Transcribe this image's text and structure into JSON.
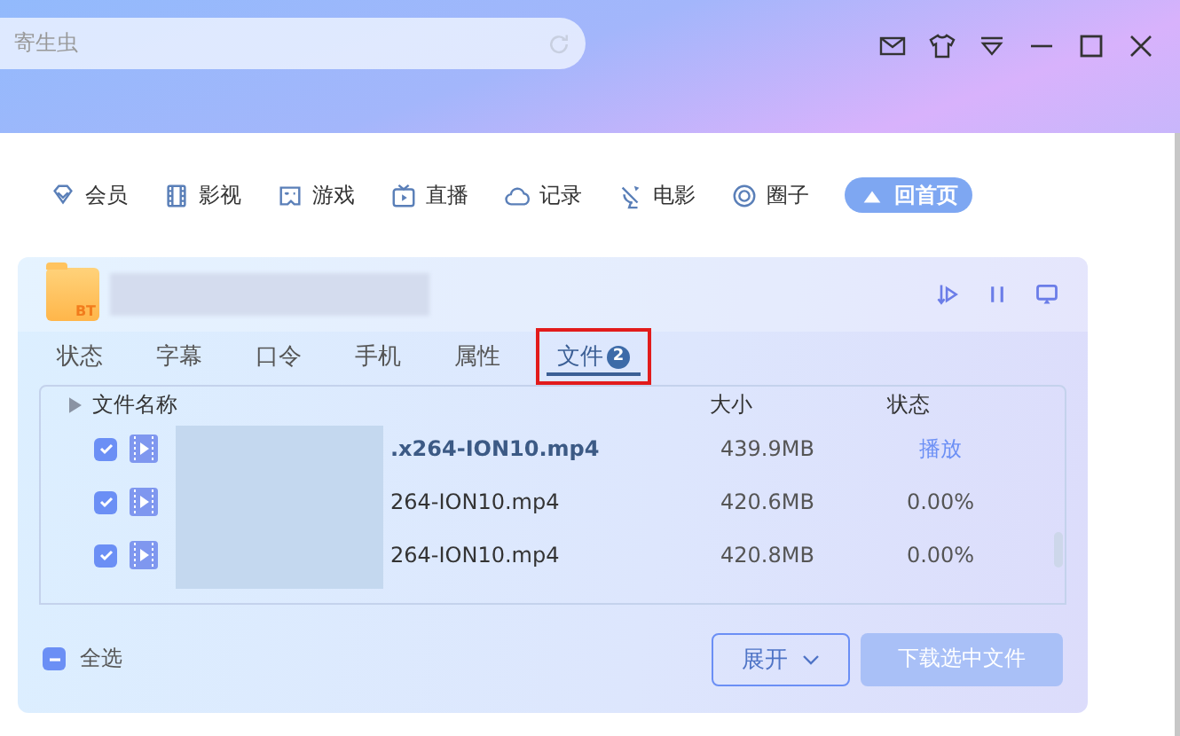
{
  "search": {
    "value": "寄生虫"
  },
  "nav": [
    {
      "label": "会员",
      "kind": "diamond",
      "selected": false
    },
    {
      "label": "影视",
      "kind": "film",
      "selected": false
    },
    {
      "label": "游戏",
      "kind": "game",
      "selected": false
    },
    {
      "label": "直播",
      "kind": "tv",
      "selected": false
    },
    {
      "label": "记录",
      "kind": "cloud",
      "selected": false
    },
    {
      "label": "电影",
      "kind": "movie",
      "selected": false
    },
    {
      "label": "圈子",
      "kind": "circle",
      "selected": false
    },
    {
      "label": "回首页",
      "kind": "home",
      "selected": true
    }
  ],
  "task": {
    "folder_badge": "BT"
  },
  "tabs": [
    {
      "label": "状态",
      "selected": false,
      "highlighted": false
    },
    {
      "label": "字幕",
      "selected": false,
      "highlighted": false
    },
    {
      "label": "口令",
      "selected": false,
      "highlighted": false
    },
    {
      "label": "手机",
      "selected": false,
      "highlighted": false
    },
    {
      "label": "属性",
      "selected": false,
      "highlighted": false
    },
    {
      "label": "文件",
      "selected": true,
      "highlighted": true,
      "count": "2"
    }
  ],
  "table": {
    "columns": [
      "文件名称",
      "大小",
      "状态"
    ],
    "rows": [
      {
        "name": ".x264-ION10.mp4",
        "size": "439.9MB",
        "status": "播放",
        "kind": "link",
        "current": true,
        "checked": true
      },
      {
        "name": "264-ION10.mp4",
        "size": "420.6MB",
        "status": "0.00%",
        "kind": "text",
        "current": false,
        "checked": true
      },
      {
        "name": "264-ION10.mp4",
        "size": "420.8MB",
        "status": "0.00%",
        "kind": "text",
        "current": false,
        "checked": true
      }
    ]
  },
  "footer": {
    "select_all": "全选",
    "select_all_partial": true,
    "expand": "展开",
    "download": "下载选中文件",
    "download_disabled": true
  }
}
